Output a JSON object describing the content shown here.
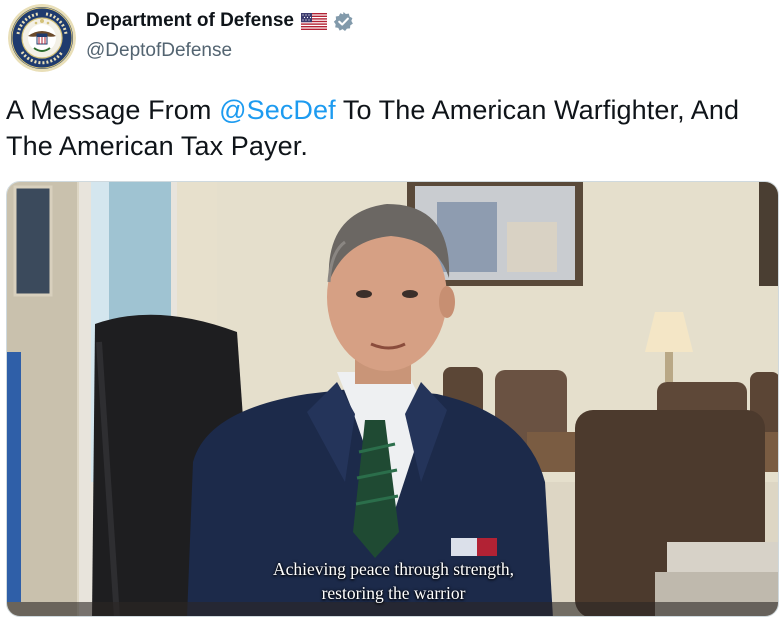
{
  "account": {
    "display_name": "Department of Defense",
    "handle": "@DeptofDefense",
    "badge_icon": "verified-government-badge-icon",
    "flag_icon": "us-flag-icon",
    "avatar_icon": "department-of-defense-seal-icon"
  },
  "tweet": {
    "text_before": "A Message From ",
    "mention": "@SecDef",
    "text_after": " To The American Warfighter, And The American Tax Payer."
  },
  "media": {
    "type": "video",
    "caption_line1": "Achieving peace through strength,",
    "caption_line2": "restoring the warrior"
  },
  "colors": {
    "link": "#1d9bf0",
    "secondary_text": "#536471",
    "verified_badge": "#829aab"
  }
}
